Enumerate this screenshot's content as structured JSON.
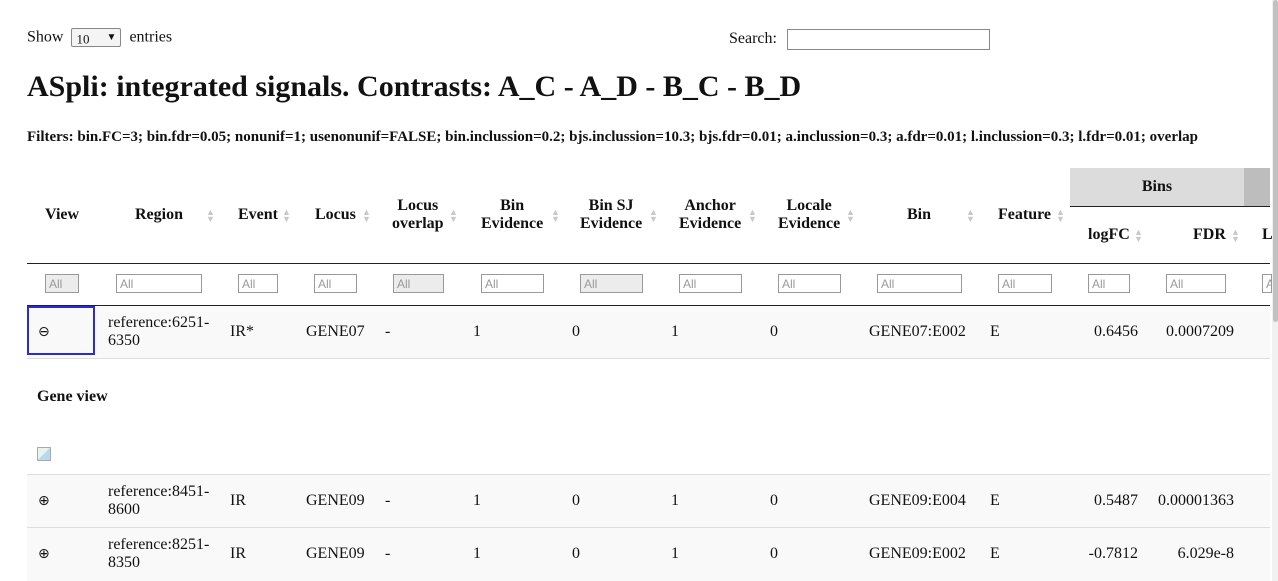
{
  "controls": {
    "show_label": "Show",
    "entries_value": "10",
    "entries_label": "entries",
    "search_label": "Search:",
    "search_value": ""
  },
  "title": "ASpli: integrated signals. Contrasts: A_C - A_D - B_C - B_D",
  "filters_text": "Filters: bin.FC=3; bin.fdr=0.05; nonunif=1; usenonunif=FALSE; bin.inclussion=0.2; bjs.inclussion=10.3; bjs.fdr=0.01; a.inclussion=0.3; a.fdr=0.01; l.inclussion=0.3; l.fdr=0.01; overlap",
  "table": {
    "group_header": "Bins",
    "columns": {
      "view": "View",
      "region": "Region",
      "event": "Event",
      "locus": "Locus",
      "locus_overlap_1": "Locus",
      "locus_overlap_2": "overlap",
      "bin_evidence_1": "Bin",
      "bin_evidence_2": "Evidence",
      "binsj_evidence_1": "Bin SJ",
      "binsj_evidence_2": "Evidence",
      "anchor_evidence_1": "Anchor",
      "anchor_evidence_2": "Evidence",
      "locale_evidence_1": "Locale",
      "locale_evidence_2": "Evidence",
      "bin": "Bin",
      "feature": "Feature",
      "logfc": "logFC",
      "fdr": "FDR",
      "cut": "L"
    },
    "filter_placeholder": "All",
    "expanded_label": "Gene view",
    "rows": [
      {
        "toggle": "⊖",
        "region_1": "reference:6251-",
        "region_2": "6350",
        "event": "IR*",
        "locus": "GENE07",
        "overlap": "-",
        "bin_ev": "1",
        "binsj_ev": "0",
        "anchor_ev": "1",
        "locale_ev": "0",
        "bin": "GENE07:E002",
        "feature": "E",
        "logfc": "0.6456",
        "fdr": "0.0007209"
      },
      {
        "toggle": "⊕",
        "region_1": "reference:8451-",
        "region_2": "8600",
        "event": "IR",
        "locus": "GENE09",
        "overlap": "-",
        "bin_ev": "1",
        "binsj_ev": "0",
        "anchor_ev": "1",
        "locale_ev": "0",
        "bin": "GENE09:E004",
        "feature": "E",
        "logfc": "0.5487",
        "fdr": "0.00001363"
      },
      {
        "toggle": "⊕",
        "region_1": "reference:8251-",
        "region_2": "8350",
        "event": "IR",
        "locus": "GENE09",
        "overlap": "-",
        "bin_ev": "1",
        "binsj_ev": "0",
        "anchor_ev": "1",
        "locale_ev": "0",
        "bin": "GENE09:E002",
        "feature": "E",
        "logfc": "-0.7812",
        "fdr": "6.029e-8"
      }
    ]
  }
}
